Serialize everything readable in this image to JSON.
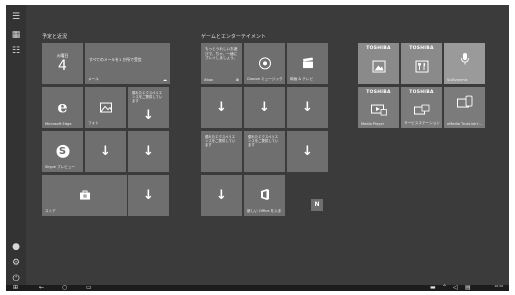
{
  "groups": {
    "left_title": "予定と近況",
    "mid_title": "ゲームとエンターテイメント"
  },
  "tiles": {
    "calendar": {
      "day_name": "火曜日",
      "day_num": "4",
      "label": ""
    },
    "mail": {
      "text": "すべてのメールを1 か所で受信",
      "label": "メール"
    },
    "edge": {
      "label": "Microsoft Edge"
    },
    "photos": {
      "label": "フォト"
    },
    "downloading_a": {
      "text": "優れたエクスペリエンスをご提供しています"
    },
    "skype": {
      "label": "Skype プレビュー"
    },
    "store": {
      "label": "ストア"
    },
    "xbox": {
      "text": "もっとうれしいお遊びで、ちゃ、一緒にプレイしましょう。",
      "label": "Xbox"
    },
    "groove": {
      "label": "Groove ミュージック"
    },
    "movies": {
      "label": "映画 & テレビ"
    },
    "dl_text_b": {
      "text": "優れたエクスペリエンスをご提供しています"
    },
    "dl_text_c": {
      "text": "優れたエクスペリエンスをご提供しています"
    },
    "office": {
      "label": "新しい Office を入手"
    },
    "toshiba_1": {
      "brand": "TOSHIBA",
      "label": ""
    },
    "toshiba_2": {
      "brand": "TOSHIBA",
      "label": ""
    },
    "toshiba_3": {
      "label": "Sullivanmic"
    },
    "toshiba_4": {
      "brand": "TOSHIBA",
      "label": "Media Player"
    },
    "toshiba_5": {
      "brand": "TOSHIBA",
      "label": "サービスステーション"
    },
    "toshiba_6": {
      "label": "eMedia TrueLink+..."
    }
  },
  "taskbar": {
    "time": "16:39",
    "date": "2016/10/04"
  },
  "colors": {
    "background": "#3b3b3b",
    "tile": "#6f6f6f",
    "taskbar": "#1c1c1c"
  }
}
